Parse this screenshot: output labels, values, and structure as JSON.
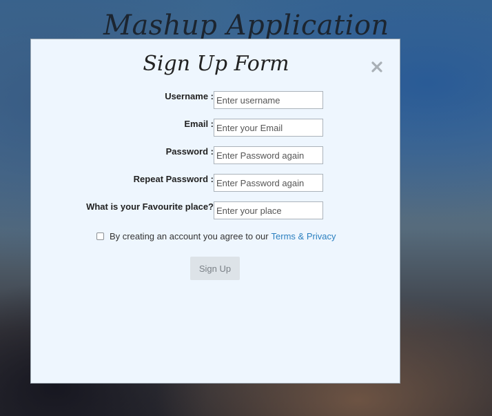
{
  "background": {
    "title": "Mashup Application"
  },
  "modal": {
    "title": "Sign Up Form",
    "close_icon": "close-icon"
  },
  "form": {
    "fields": [
      {
        "label": "Username :",
        "placeholder": "Enter username",
        "value": ""
      },
      {
        "label": "Email :",
        "placeholder": "Enter your Email",
        "value": ""
      },
      {
        "label": "Password :",
        "placeholder": "Enter Password again",
        "value": ""
      },
      {
        "label": "Repeat Password :",
        "placeholder": "Enter Password again",
        "value": ""
      },
      {
        "label": "What is your Favourite place?",
        "placeholder": "Enter your place",
        "value": ""
      }
    ],
    "terms_text": "By creating an account you agree to our",
    "terms_link": "Terms & Privacy",
    "terms_checked": false,
    "submit_label": "Sign Up"
  },
  "colors": {
    "modal_bg": "#eef6fe",
    "link": "#2a7fbf",
    "button_bg": "#dde3e8"
  }
}
